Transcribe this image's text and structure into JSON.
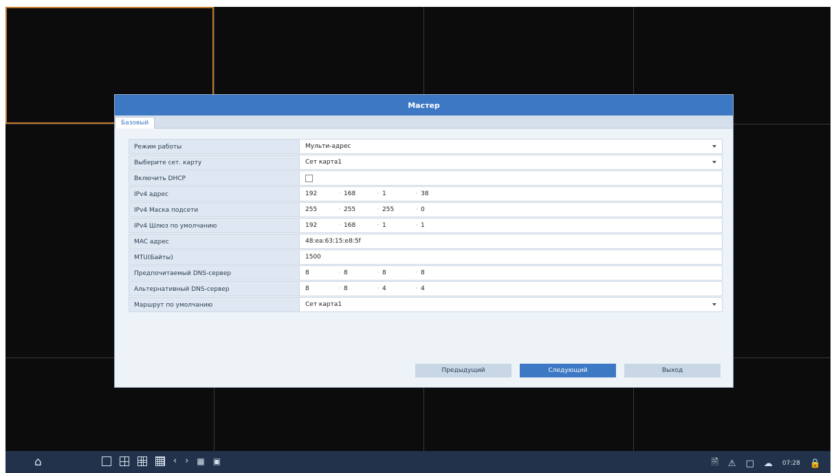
{
  "dialog": {
    "title": "Мастер",
    "tab_label": "Базовый",
    "fields": [
      {
        "label": "Режим работы",
        "value": "Мульти-адрес",
        "type": "select"
      },
      {
        "label": "Выберите сет. карту",
        "value": "Сет карта1",
        "type": "select"
      },
      {
        "label": "Включить DHCP",
        "value": "",
        "type": "checkbox",
        "checked": false
      },
      {
        "label": "IPv4 адрес",
        "type": "ip",
        "octets": [
          "192",
          "168",
          "1",
          "38"
        ]
      },
      {
        "label": "IPv4 Маска подсети",
        "type": "ip",
        "octets": [
          "255",
          "255",
          "255",
          "0"
        ]
      },
      {
        "label": "IPv4 Шлюз по умолчанию",
        "type": "ip",
        "octets": [
          "192",
          "168",
          "1",
          "1"
        ]
      },
      {
        "label": "MAC адрес",
        "value": "48:ea:63:15:e8:5f",
        "type": "text"
      },
      {
        "label": "MTU(Байты)",
        "value": "1500",
        "type": "text"
      },
      {
        "label": "Предпочитаемый DNS-сервер",
        "type": "ip",
        "octets": [
          "8",
          "8",
          "8",
          "8"
        ]
      },
      {
        "label": "Альтернативный DNS-сервер",
        "type": "ip",
        "octets": [
          "8",
          "8",
          "4",
          "4"
        ]
      },
      {
        "label": "Маршрут по умолчанию",
        "value": "Сет карта1",
        "type": "select"
      }
    ],
    "buttons": {
      "previous": "Предыдущий",
      "next": "Следующий",
      "exit": "Выход"
    }
  },
  "taskbar": {
    "time": "07:28",
    "icons": [
      "home-icon",
      "layout-1-icon",
      "layout-4-icon",
      "layout-9-icon",
      "layout-16-icon",
      "prev-icon",
      "next-icon",
      "sequence-icon",
      "fullscreen-icon",
      "document-icon",
      "alarm-icon",
      "display-icon",
      "cloud-icon",
      "lock-icon"
    ]
  },
  "colors": {
    "accent": "#3d78c4",
    "selected_cell_border": "#c0782e",
    "taskbar": "#22324a"
  }
}
